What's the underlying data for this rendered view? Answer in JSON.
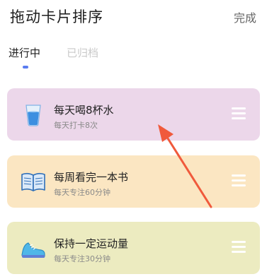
{
  "header": {
    "title": "拖动卡片排序",
    "done_label": "完成"
  },
  "tabs": [
    {
      "label": "进行中",
      "active": true
    },
    {
      "label": "已归档",
      "active": false
    }
  ],
  "colors": {
    "accent": "#5a7cf0",
    "card1": "#ecd7ea",
    "card2": "#fbe6c2",
    "card3": "#ecebc0",
    "arrow": "#f05a3c"
  },
  "cards": [
    {
      "title": "每天喝8杯水",
      "subtitle": "每天打卡8次",
      "icon": "water-glass-icon"
    },
    {
      "title": "每周看完一本书",
      "subtitle": "每天专注60分钟",
      "icon": "open-book-icon"
    },
    {
      "title": "保持一定运动量",
      "subtitle": "每天专注30分钟",
      "icon": "running-shoe-icon"
    }
  ]
}
